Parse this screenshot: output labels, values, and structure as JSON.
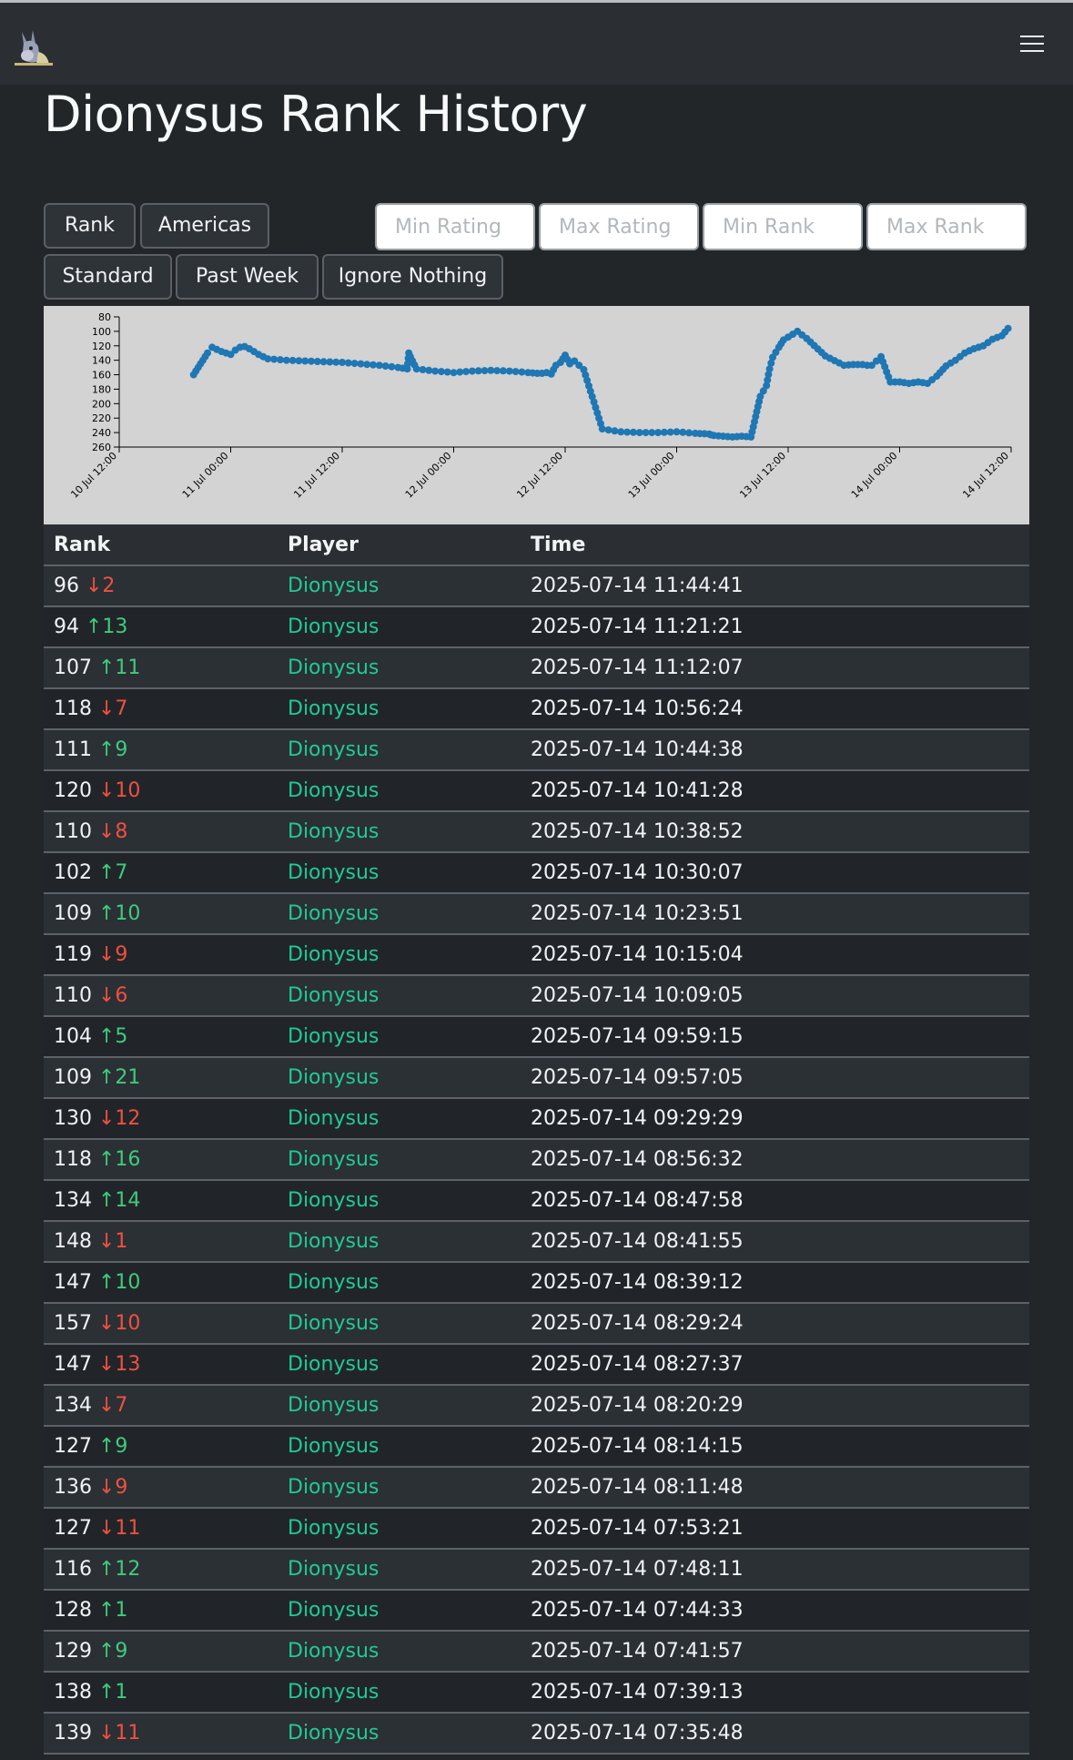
{
  "page": {
    "title": "Dionysus Rank History"
  },
  "buttons": {
    "rank": "Rank",
    "region": "Americas",
    "mode": "Standard",
    "period": "Past Week",
    "ignore": "Ignore Nothing"
  },
  "filters": {
    "min_rating": "Min Rating",
    "max_rating": "Max Rating",
    "min_rank": "Min Rank",
    "max_rank": "Max Rank"
  },
  "colors": {
    "up": "#3ecb7c",
    "down": "#f0503f",
    "player": "#20c997",
    "point": "#1f77b4"
  },
  "chart_data": {
    "type": "scatter",
    "y_inverted": true,
    "ylim": [
      80,
      260
    ],
    "yticks": [
      80,
      100,
      120,
      140,
      160,
      180,
      200,
      220,
      240,
      260
    ],
    "xlim": [
      "2025-07-10T12:00",
      "2025-07-14T12:00"
    ],
    "xticks": [
      "10 Jul 12:00",
      "11 Jul 00:00",
      "11 Jul 12:00",
      "12 Jul 00:00",
      "12 Jul 12:00",
      "13 Jul 00:00",
      "13 Jul 12:00",
      "14 Jul 00:00",
      "14 Jul 12:00"
    ],
    "grid": false,
    "series": [
      {
        "x": [
          "2025-07-10T20:00",
          "2025-07-10T20:30",
          "2025-07-10T21:00",
          "2025-07-10T21:30",
          "2025-07-10T22:00",
          "2025-07-10T22:30",
          "2025-07-10T23:00",
          "2025-07-10T23:30",
          "2025-07-11T00:00",
          "2025-07-11T00:30",
          "2025-07-11T01:00",
          "2025-07-11T01:30",
          "2025-07-11T02:00",
          "2025-07-11T03:00",
          "2025-07-11T04:00",
          "2025-07-11T06:00",
          "2025-07-11T08:00",
          "2025-07-11T10:00",
          "2025-07-11T12:00",
          "2025-07-11T14:00",
          "2025-07-11T16:00",
          "2025-07-11T18:00",
          "2025-07-11T19:00",
          "2025-07-11T19:10",
          "2025-07-11T19:20",
          "2025-07-11T20:00",
          "2025-07-11T22:00",
          "2025-07-12T00:00",
          "2025-07-12T02:00",
          "2025-07-12T04:00",
          "2025-07-12T06:00",
          "2025-07-12T08:00",
          "2025-07-12T09:00",
          "2025-07-12T09:30",
          "2025-07-12T10:00",
          "2025-07-12T10:30",
          "2025-07-12T11:00",
          "2025-07-12T11:30",
          "2025-07-12T12:00",
          "2025-07-12T12:30",
          "2025-07-12T13:00",
          "2025-07-12T14:00",
          "2025-07-12T16:00",
          "2025-07-12T18:00",
          "2025-07-12T20:00",
          "2025-07-12T22:00",
          "2025-07-13T00:00",
          "2025-07-13T02:00",
          "2025-07-13T03:30",
          "2025-07-13T03:40",
          "2025-07-13T04:00",
          "2025-07-13T05:00",
          "2025-07-13T06:00",
          "2025-07-13T07:00",
          "2025-07-13T08:00",
          "2025-07-13T09:00",
          "2025-07-13T09:40",
          "2025-07-13T10:00",
          "2025-07-13T10:20",
          "2025-07-13T11:00",
          "2025-07-13T11:30",
          "2025-07-13T12:00",
          "2025-07-13T13:00",
          "2025-07-13T14:00",
          "2025-07-13T16:00",
          "2025-07-13T18:00",
          "2025-07-13T19:00",
          "2025-07-13T19:30",
          "2025-07-13T20:00",
          "2025-07-13T20:30",
          "2025-07-13T21:00",
          "2025-07-13T22:00",
          "2025-07-13T23:00",
          "2025-07-13T23:30",
          "2025-07-14T00:00",
          "2025-07-14T00:30",
          "2025-07-14T01:00",
          "2025-07-14T02:00",
          "2025-07-14T03:00",
          "2025-07-14T04:00",
          "2025-07-14T05:00",
          "2025-07-14T06:00",
          "2025-07-14T07:00",
          "2025-07-14T08:00",
          "2025-07-14T09:00",
          "2025-07-14T10:00",
          "2025-07-14T11:00",
          "2025-07-14T11:40"
        ],
        "y": [
          160,
          150,
          140,
          130,
          122,
          125,
          128,
          130,
          132,
          126,
          122,
          121,
          124,
          132,
          138,
          140,
          141,
          142,
          143,
          145,
          147,
          150,
          152,
          130,
          135,
          152,
          155,
          157,
          155,
          154,
          155,
          157,
          158,
          158,
          157,
          159,
          147,
          143,
          133,
          145,
          141,
          153,
          235,
          239,
          240,
          240,
          239,
          241,
          242,
          243,
          244,
          245,
          246,
          245,
          246,
          190,
          175,
          152,
          136,
          122,
          112,
          108,
          100,
          110,
          134,
          147,
          146,
          146,
          146,
          147,
          147,
          135,
          170,
          170,
          170,
          171,
          172,
          170,
          172,
          162,
          148,
          140,
          130,
          124,
          120,
          111,
          106,
          96
        ]
      }
    ]
  },
  "table": {
    "headers": [
      "Rank",
      "Player",
      "Time"
    ],
    "rows": [
      {
        "rank": "96",
        "dir": "down",
        "delta": "↓2",
        "player": "Dionysus",
        "time": "2025-07-14 11:44:41"
      },
      {
        "rank": "94",
        "dir": "up",
        "delta": "↑13",
        "player": "Dionysus",
        "time": "2025-07-14 11:21:21"
      },
      {
        "rank": "107",
        "dir": "up",
        "delta": "↑11",
        "player": "Dionysus",
        "time": "2025-07-14 11:12:07"
      },
      {
        "rank": "118",
        "dir": "down",
        "delta": "↓7",
        "player": "Dionysus",
        "time": "2025-07-14 10:56:24"
      },
      {
        "rank": "111",
        "dir": "up",
        "delta": "↑9",
        "player": "Dionysus",
        "time": "2025-07-14 10:44:38"
      },
      {
        "rank": "120",
        "dir": "down",
        "delta": "↓10",
        "player": "Dionysus",
        "time": "2025-07-14 10:41:28"
      },
      {
        "rank": "110",
        "dir": "down",
        "delta": "↓8",
        "player": "Dionysus",
        "time": "2025-07-14 10:38:52"
      },
      {
        "rank": "102",
        "dir": "up",
        "delta": "↑7",
        "player": "Dionysus",
        "time": "2025-07-14 10:30:07"
      },
      {
        "rank": "109",
        "dir": "up",
        "delta": "↑10",
        "player": "Dionysus",
        "time": "2025-07-14 10:23:51"
      },
      {
        "rank": "119",
        "dir": "down",
        "delta": "↓9",
        "player": "Dionysus",
        "time": "2025-07-14 10:15:04"
      },
      {
        "rank": "110",
        "dir": "down",
        "delta": "↓6",
        "player": "Dionysus",
        "time": "2025-07-14 10:09:05"
      },
      {
        "rank": "104",
        "dir": "up",
        "delta": "↑5",
        "player": "Dionysus",
        "time": "2025-07-14 09:59:15"
      },
      {
        "rank": "109",
        "dir": "up",
        "delta": "↑21",
        "player": "Dionysus",
        "time": "2025-07-14 09:57:05"
      },
      {
        "rank": "130",
        "dir": "down",
        "delta": "↓12",
        "player": "Dionysus",
        "time": "2025-07-14 09:29:29"
      },
      {
        "rank": "118",
        "dir": "up",
        "delta": "↑16",
        "player": "Dionysus",
        "time": "2025-07-14 08:56:32"
      },
      {
        "rank": "134",
        "dir": "up",
        "delta": "↑14",
        "player": "Dionysus",
        "time": "2025-07-14 08:47:58"
      },
      {
        "rank": "148",
        "dir": "down",
        "delta": "↓1",
        "player": "Dionysus",
        "time": "2025-07-14 08:41:55"
      },
      {
        "rank": "147",
        "dir": "up",
        "delta": "↑10",
        "player": "Dionysus",
        "time": "2025-07-14 08:39:12"
      },
      {
        "rank": "157",
        "dir": "down",
        "delta": "↓10",
        "player": "Dionysus",
        "time": "2025-07-14 08:29:24"
      },
      {
        "rank": "147",
        "dir": "down",
        "delta": "↓13",
        "player": "Dionysus",
        "time": "2025-07-14 08:27:37"
      },
      {
        "rank": "134",
        "dir": "down",
        "delta": "↓7",
        "player": "Dionysus",
        "time": "2025-07-14 08:20:29"
      },
      {
        "rank": "127",
        "dir": "up",
        "delta": "↑9",
        "player": "Dionysus",
        "time": "2025-07-14 08:14:15"
      },
      {
        "rank": "136",
        "dir": "down",
        "delta": "↓9",
        "player": "Dionysus",
        "time": "2025-07-14 08:11:48"
      },
      {
        "rank": "127",
        "dir": "down",
        "delta": "↓11",
        "player": "Dionysus",
        "time": "2025-07-14 07:53:21"
      },
      {
        "rank": "116",
        "dir": "up",
        "delta": "↑12",
        "player": "Dionysus",
        "time": "2025-07-14 07:48:11"
      },
      {
        "rank": "128",
        "dir": "up",
        "delta": "↑1",
        "player": "Dionysus",
        "time": "2025-07-14 07:44:33"
      },
      {
        "rank": "129",
        "dir": "up",
        "delta": "↑9",
        "player": "Dionysus",
        "time": "2025-07-14 07:41:57"
      },
      {
        "rank": "138",
        "dir": "up",
        "delta": "↑1",
        "player": "Dionysus",
        "time": "2025-07-14 07:39:13"
      },
      {
        "rank": "139",
        "dir": "down",
        "delta": "↓11",
        "player": "Dionysus",
        "time": "2025-07-14 07:35:48"
      }
    ]
  }
}
